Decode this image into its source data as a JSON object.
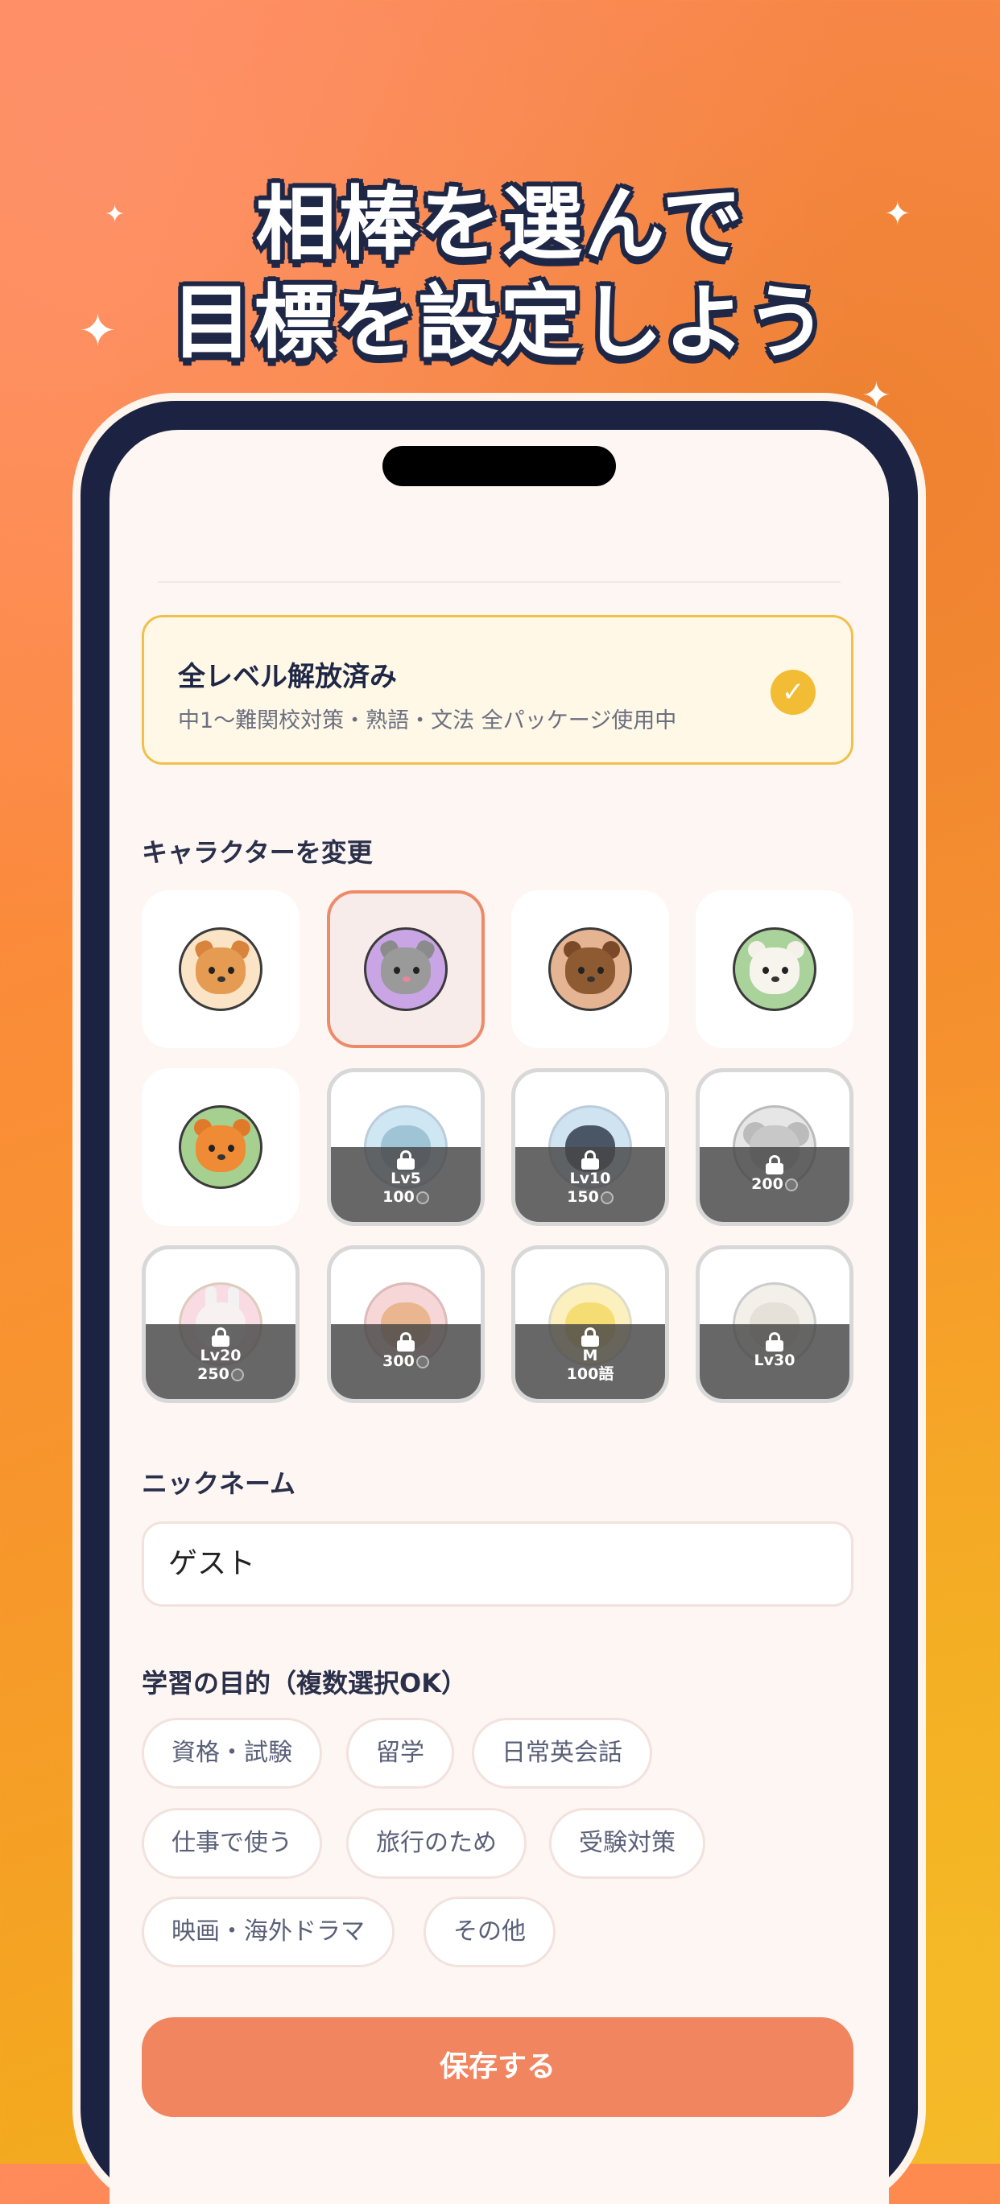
{
  "headline": {
    "line1": "相棒を選んで",
    "line2": "目標を設定しよう"
  },
  "unlock_card": {
    "title": "全レベル解放済み",
    "subtitle": "中1〜難関校対策・熟語・文法 全パッケージ使用中",
    "check_icon": "check-icon"
  },
  "characters_section": {
    "label": "キャラクターを変更"
  },
  "characters": [
    {
      "id": "shiba",
      "locked": false,
      "selected": false,
      "level": "",
      "cost": ""
    },
    {
      "id": "cat",
      "locked": false,
      "selected": true,
      "level": "",
      "cost": ""
    },
    {
      "id": "bear",
      "locked": false,
      "selected": false,
      "level": "",
      "cost": ""
    },
    {
      "id": "polar-bear",
      "locked": false,
      "selected": false,
      "level": "",
      "cost": ""
    },
    {
      "id": "tiger",
      "locked": false,
      "selected": false,
      "level": "",
      "cost": ""
    },
    {
      "id": "dolphin",
      "locked": true,
      "selected": false,
      "level": "Lv5",
      "cost": "100"
    },
    {
      "id": "penguin",
      "locked": true,
      "selected": false,
      "level": "Lv10",
      "cost": "150"
    },
    {
      "id": "koala",
      "locked": true,
      "selected": false,
      "level": "",
      "cost": "200"
    },
    {
      "id": "rabbit",
      "locked": true,
      "selected": false,
      "level": "Lv20",
      "cost": "250"
    },
    {
      "id": "hamster",
      "locked": true,
      "selected": false,
      "level": "",
      "cost": "300"
    },
    {
      "id": "chick",
      "locked": true,
      "selected": false,
      "level": "M",
      "cost": "100語"
    },
    {
      "id": "sheep",
      "locked": true,
      "selected": false,
      "level": "Lv30",
      "cost": ""
    }
  ],
  "nickname_section": {
    "label": "ニックネーム",
    "value": "ゲスト"
  },
  "goal_section": {
    "label": "学習の目的（複数選択OK）"
  },
  "goals": [
    "資格・試験",
    "留学",
    "日常英会話",
    "仕事で使う",
    "旅行のため",
    "受験対策",
    "映画・海外ドラマ",
    "その他"
  ],
  "save_label": "保存する",
  "colors": {
    "accent": "#f08560",
    "navy": "#1c2342",
    "gold": "#f3bc35"
  }
}
